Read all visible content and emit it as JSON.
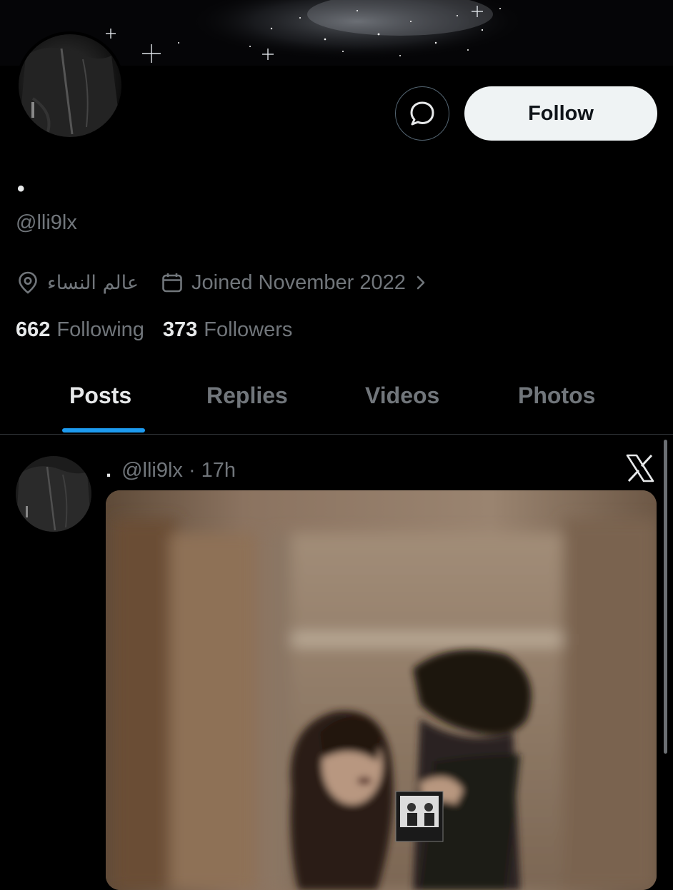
{
  "profile": {
    "display_name": "•",
    "handle": "@lli9lx",
    "location": "عالم النساء",
    "joined": "Joined November 2022",
    "following_count": "662",
    "following_label": "Following",
    "followers_count": "373",
    "followers_label": "Followers"
  },
  "actions": {
    "follow_label": "Follow"
  },
  "tabs": [
    {
      "label": "Posts",
      "active": true
    },
    {
      "label": "Replies",
      "active": false
    },
    {
      "label": "Videos",
      "active": false
    },
    {
      "label": "Photos",
      "active": false
    }
  ],
  "post": {
    "author_name": ".",
    "handle_time": "@lli9lx · 17h"
  },
  "colors": {
    "background": "#000000",
    "text_primary": "#e7e9ea",
    "text_secondary": "#71767b",
    "accent": "#1d9bf0",
    "follow_button_bg": "#eff3f4"
  },
  "icons": [
    "message-icon",
    "location-icon",
    "calendar-icon",
    "chevron-right-icon",
    "x-logo-icon"
  ]
}
